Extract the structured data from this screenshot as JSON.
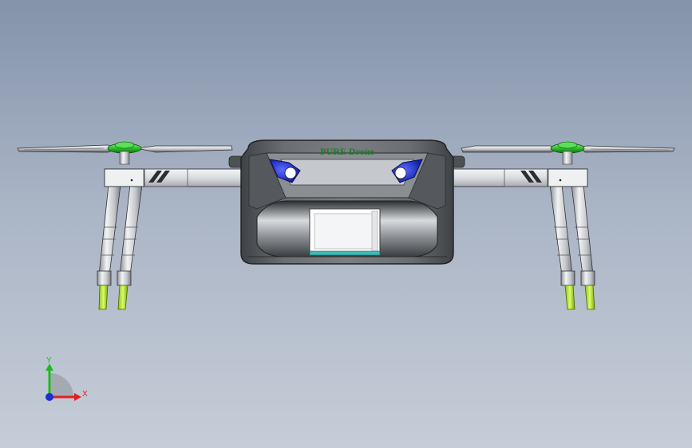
{
  "model": {
    "brand_text": "PURE Drone"
  },
  "triad": {
    "x_label": "X",
    "y_label": "Y",
    "colors": {
      "x": "#e02020",
      "y": "#22b822",
      "z": "#2030d0"
    }
  },
  "colors": {
    "background_top": "#8493aa",
    "background_bottom": "#c6cdd8",
    "body": "#5e6165",
    "arm": "#e3e5e8",
    "hub": "#33cc33",
    "leg_tip": "#b7e63a",
    "eye": "#1c2fd6"
  }
}
